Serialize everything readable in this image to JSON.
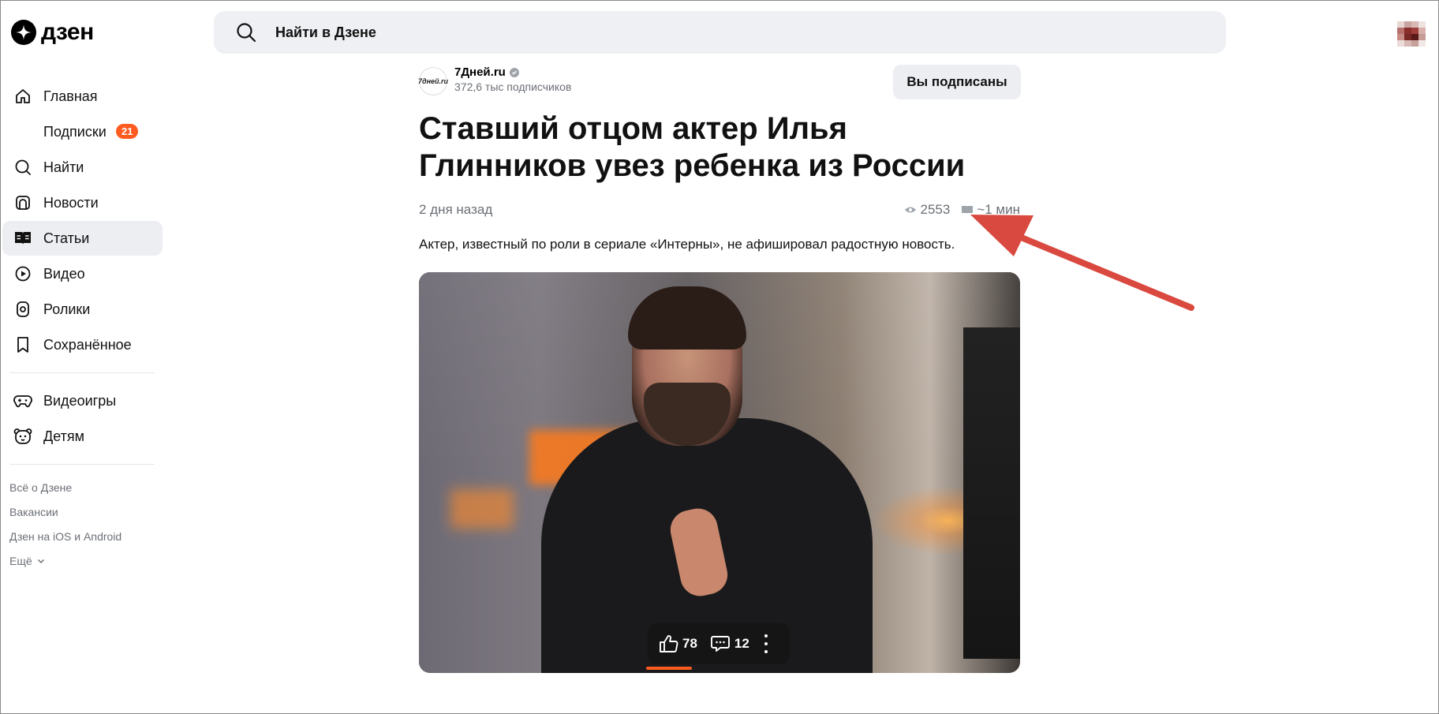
{
  "header": {
    "logo_text": "дзен",
    "search_placeholder": "Найти в Дзене"
  },
  "sidebar": {
    "items": [
      {
        "label": "Главная",
        "icon": "home-icon"
      },
      {
        "label": "Подписки",
        "icon": "",
        "badge": "21"
      },
      {
        "label": "Найти",
        "icon": "search-icon"
      },
      {
        "label": "Новости",
        "icon": "news-icon"
      },
      {
        "label": "Статьи",
        "icon": "articles-icon",
        "active": true
      },
      {
        "label": "Видео",
        "icon": "video-icon"
      },
      {
        "label": "Ролики",
        "icon": "shorts-icon"
      },
      {
        "label": "Сохранённое",
        "icon": "bookmark-icon"
      }
    ],
    "items2": [
      {
        "label": "Видеоигры",
        "icon": "gamepad-icon"
      },
      {
        "label": "Детям",
        "icon": "kids-icon"
      }
    ],
    "footer_links": [
      "Всё о Дзене",
      "Вакансии",
      "Дзен на iOS и Android",
      "Ещё"
    ]
  },
  "article": {
    "channel_logo_text": "7дней.ru",
    "channel_name": "7Дней.ru",
    "channel_subscribers": "372,6 тыс подписчиков",
    "subscribe_label": "Вы подписаны",
    "title": "Ставший отцом актер Илья Глинников увез ребенка из России",
    "date": "2 дня назад",
    "views": "2553",
    "read_time": "~1 мин",
    "lead": "Актер, известный по роли в сериале «Интерны», не афишировал радостную новость.",
    "likes": "78",
    "comments": "12"
  },
  "colors": {
    "accent": "#ff5a1f",
    "annotation_arrow": "#d9493f"
  }
}
